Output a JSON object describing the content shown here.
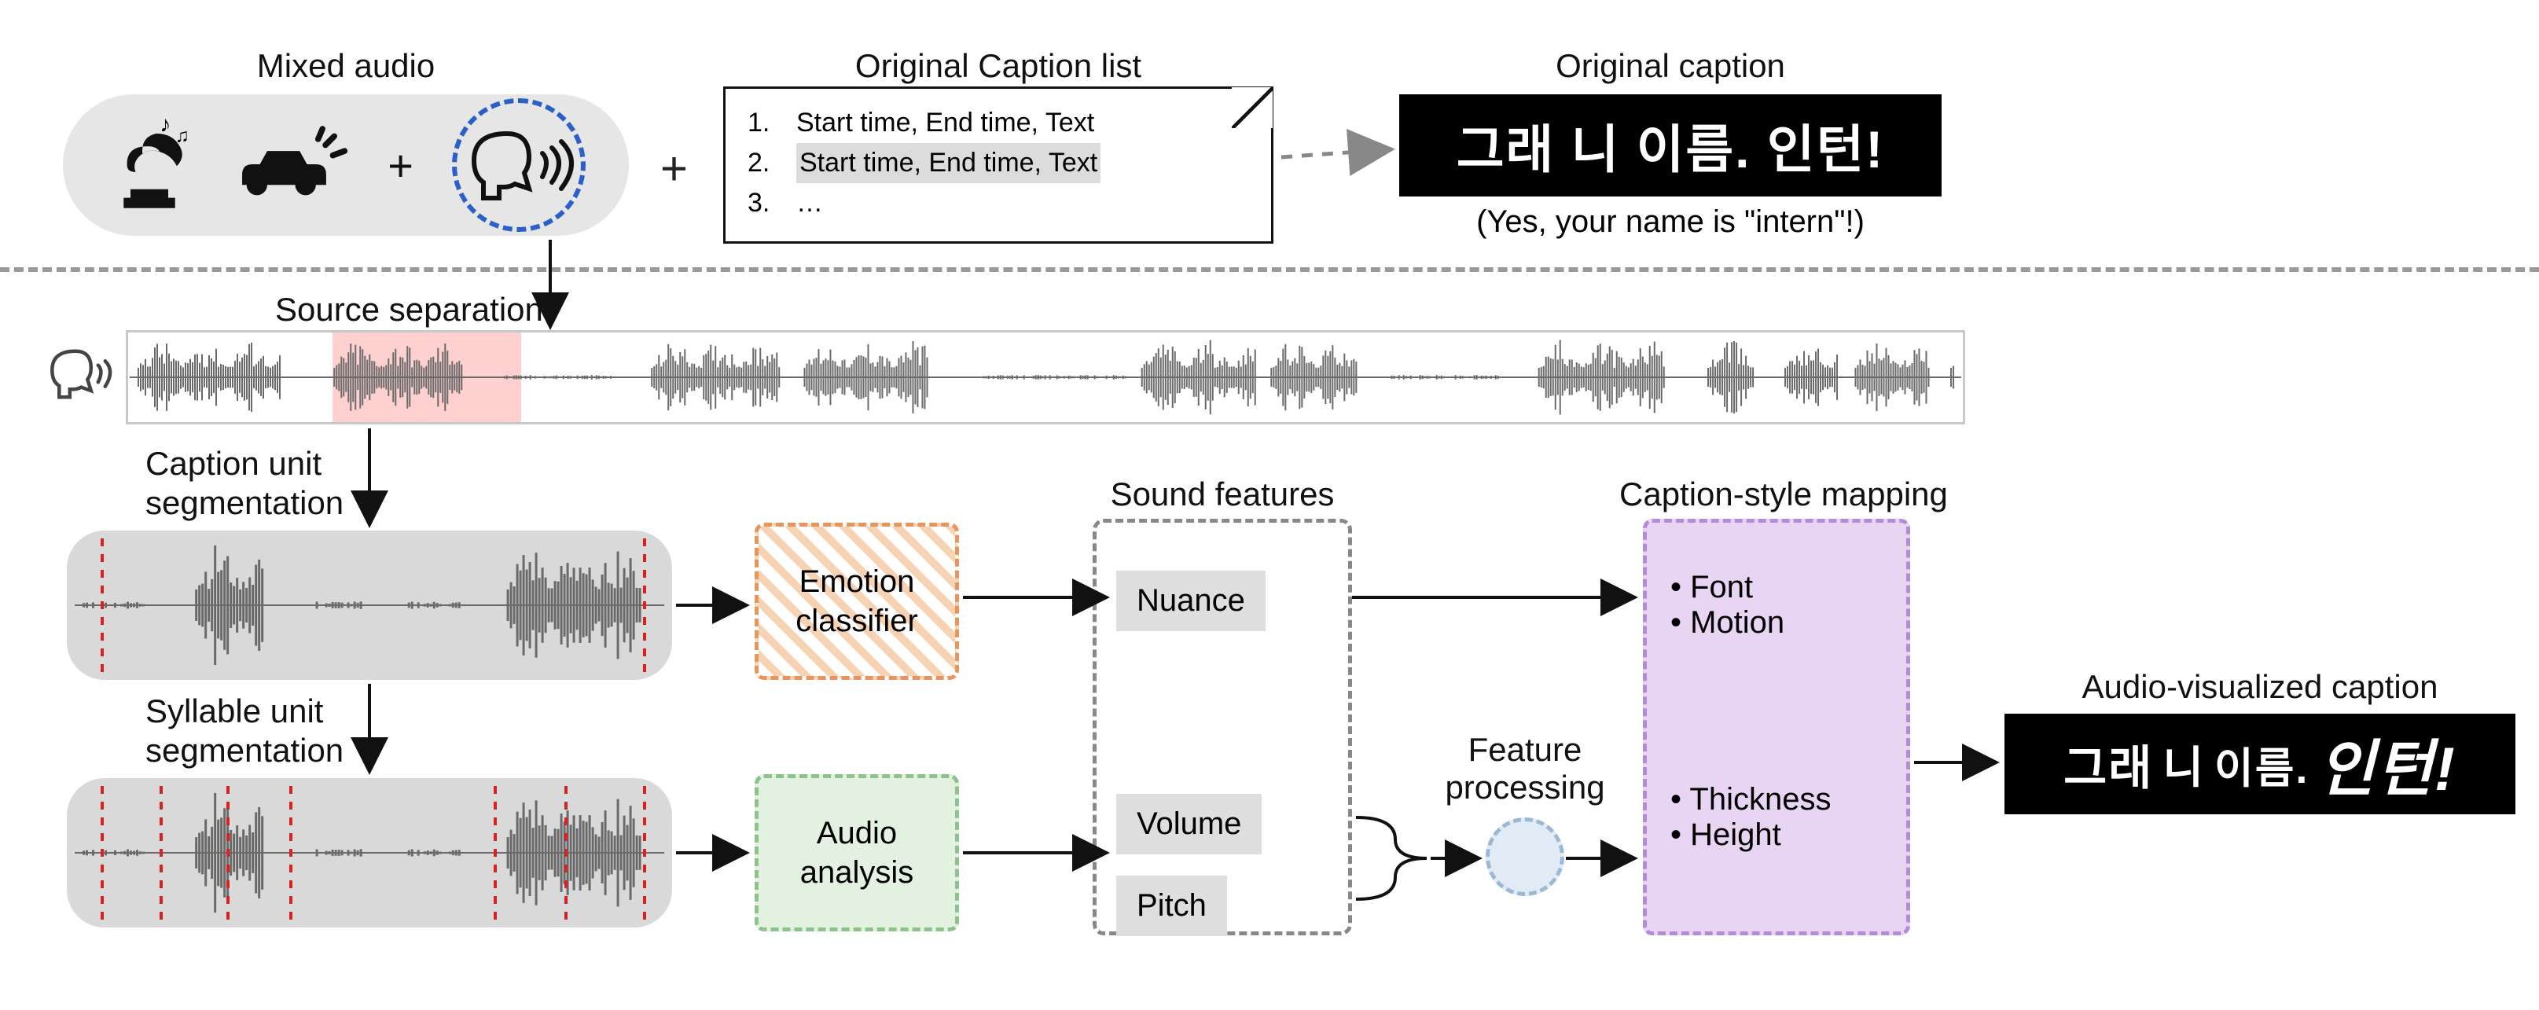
{
  "headers": {
    "mixed_audio": "Mixed audio",
    "orig_caption_list": "Original Caption list",
    "orig_caption": "Original caption",
    "source_separation": "Source separation",
    "caption_unit_seg": "Caption unit\nsegmentation",
    "syllable_unit_seg": "Syllable unit\nsegmentation",
    "sound_features": "Sound features",
    "feature_processing": "Feature\nprocessing",
    "caption_style_mapping": "Caption-style mapping",
    "audio_vis_caption": "Audio-visualized caption"
  },
  "caption_list": {
    "row1_num": "1.",
    "row1_text": "Start time, End time, Text",
    "row2_num": "2.",
    "row2_text": "Start time, End time, Text",
    "row3_num": "3.",
    "row3_text": "…"
  },
  "captions": {
    "original_text": "그래 니 이름. 인턴!",
    "translation": "(Yes, your name is \"intern\"!)",
    "avc_w1": "그래",
    "avc_w2": "니",
    "avc_w3": "이름.",
    "avc_w4": "인턴!"
  },
  "modules": {
    "emotion": "Emotion\nclassifier",
    "audio_analysis": "Audio\nanalysis"
  },
  "features": {
    "nuance": "Nuance",
    "volume": "Volume",
    "pitch": "Pitch"
  },
  "mapping": {
    "font": "• Font",
    "motion": "• Motion",
    "thickness": "• Thickness",
    "height": "• Height"
  },
  "symbols": {
    "plus": "+"
  }
}
